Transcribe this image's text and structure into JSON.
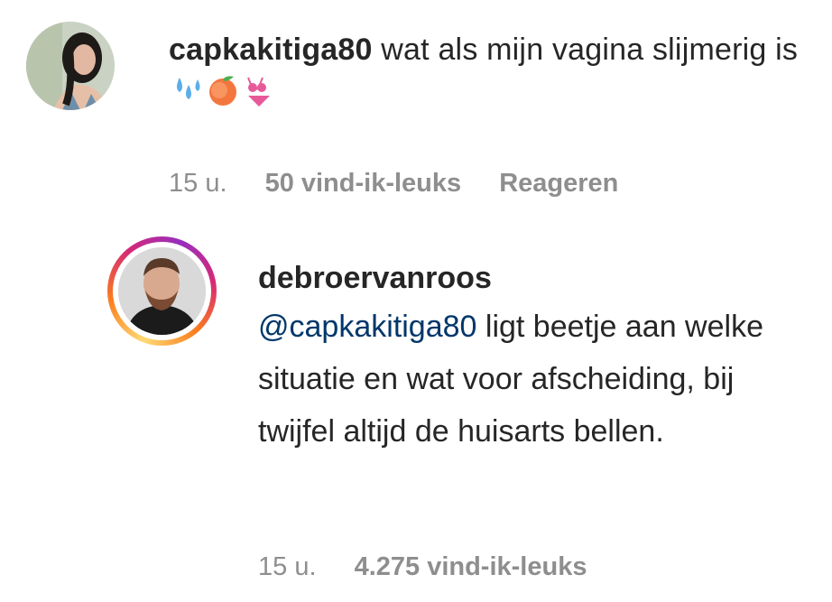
{
  "comments": [
    {
      "username": "capkakitiga80",
      "text": "wat als mijn vagina slijmerig is",
      "emoji": [
        "sweat-droplets",
        "peach",
        "bikini"
      ],
      "time": "15 u.",
      "likes": "50 vind-ik-leuks",
      "reply_label": "Reageren"
    },
    {
      "username": "debroervanroos",
      "mention": "@capkakitiga80",
      "text": "ligt beetje aan welke situatie en wat voor afscheiding, bij twijfel altijd de huisarts bellen.",
      "time": "15 u.",
      "likes": "4.275 vind-ik-leuks",
      "story_ring": true
    }
  ],
  "colors": {
    "text": "#262626",
    "meta": "#8e8e8e",
    "mention": "#00376b"
  }
}
